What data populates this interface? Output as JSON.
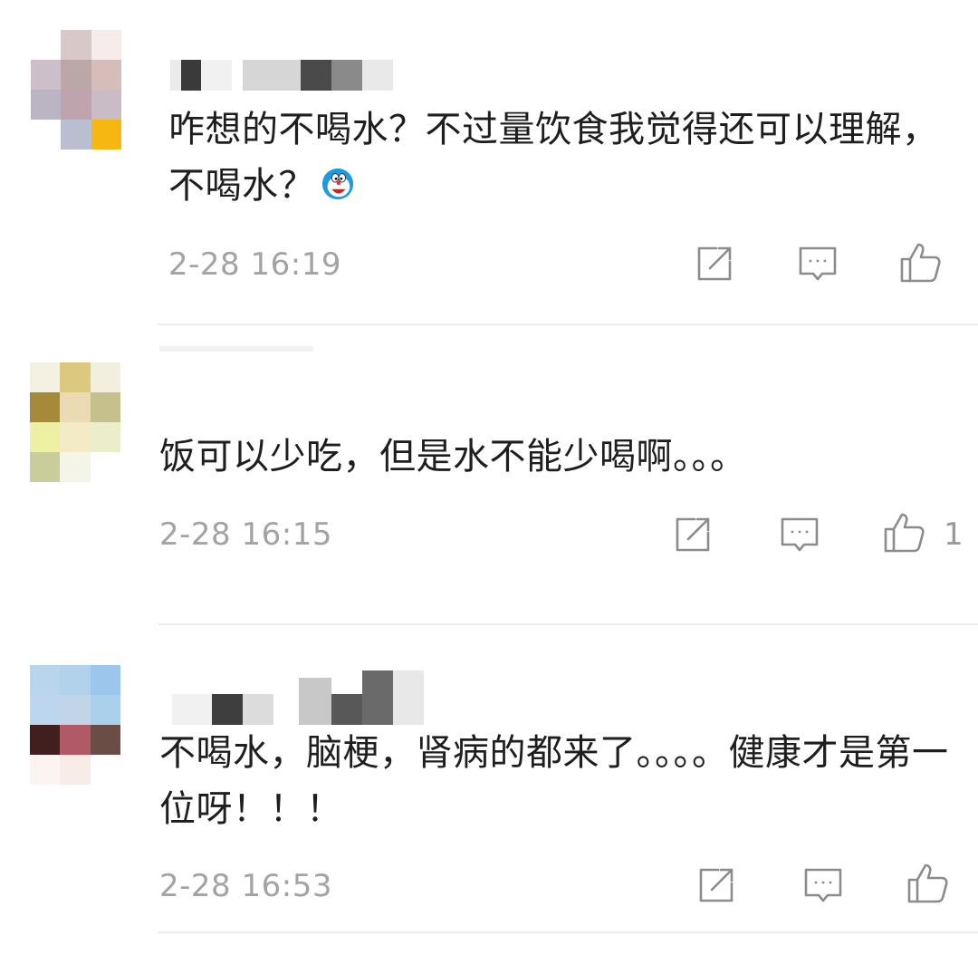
{
  "comments": [
    {
      "text": "咋想的不喝水？不过量饮食我觉得还可以理解，不喝水？",
      "time": "2-28 16:19",
      "like_count": "",
      "emoji": "doraemon-face-icon"
    },
    {
      "text": "饭可以少吃，但是水不能少喝啊。。。",
      "time": "2-28 16:15",
      "like_count": "1"
    },
    {
      "text": "不喝水，脑梗，肾病的都来了。。。。健康才是第一位呀！！！",
      "time": "2-28 16:53",
      "like_count": ""
    }
  ],
  "icons": {
    "share": "share-icon",
    "reply": "comment-icon",
    "like": "thumbs-up-icon"
  },
  "colors": {
    "text": "#1e1e1e",
    "meta": "#a3a3a3",
    "icon": "#8c8c8c",
    "divider": "#ececec"
  }
}
